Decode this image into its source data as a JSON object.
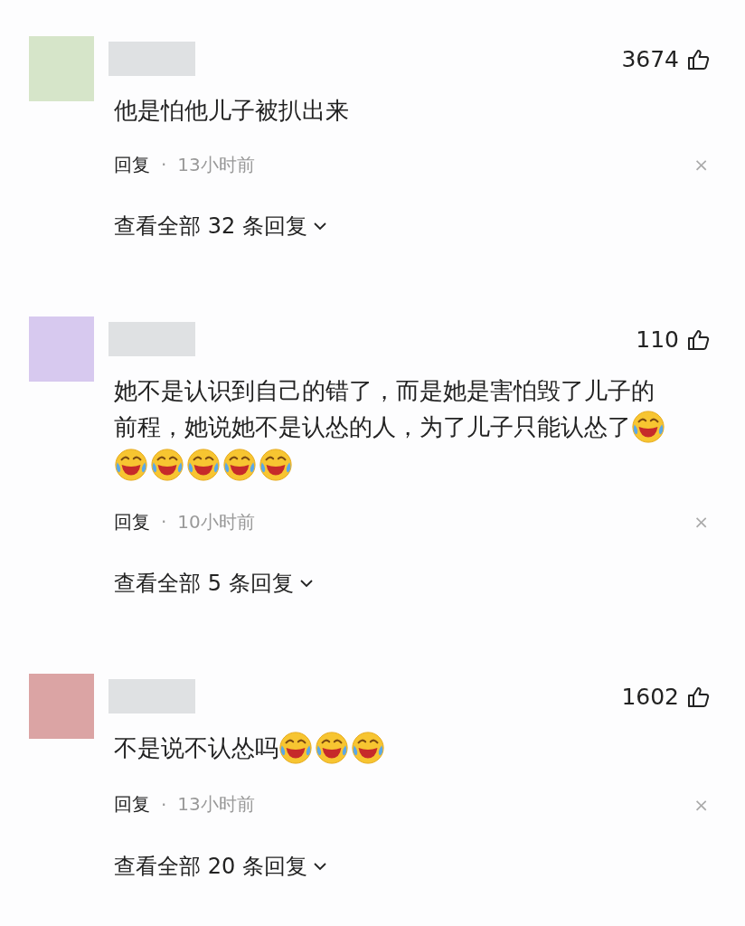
{
  "comments": [
    {
      "avatar": {
        "color": "#d6e5c9"
      },
      "author": {
        "kind": "redacted"
      },
      "likes": "3674",
      "content": [
        {
          "kind": "text",
          "text": "他是怕他儿子被扒出来"
        }
      ],
      "reply_label": "回复",
      "separator": "·",
      "time": "13小时前",
      "close": "×",
      "view_replies": "查看全部 32 条回复"
    },
    {
      "avatar": {
        "color": "#d7c9ef"
      },
      "author": {
        "kind": "redacted"
      },
      "likes": "110",
      "content": [
        {
          "kind": "text",
          "text": "她不是认识到自己的错了，而是她是害怕毁了儿子的"
        },
        {
          "kind": "text",
          "text": "前程，她说她不是认怂的人，为了儿子只能认怂了"
        },
        {
          "kind": "emoji"
        },
        {
          "kind": "emoji"
        },
        {
          "kind": "emoji"
        },
        {
          "kind": "emoji"
        },
        {
          "kind": "emoji"
        },
        {
          "kind": "emoji"
        }
      ],
      "reply_label": "回复",
      "separator": "·",
      "time": "10小时前",
      "close": "×",
      "view_replies": "查看全部 5 条回复"
    },
    {
      "avatar": {
        "color": "#dba4a4"
      },
      "author": {
        "kind": "redacted"
      },
      "likes": "1602",
      "content": [
        {
          "kind": "text",
          "text": "不是说不认怂吗"
        },
        {
          "kind": "emoji"
        },
        {
          "kind": "emoji"
        },
        {
          "kind": "emoji"
        }
      ],
      "reply_label": "回复",
      "separator": "·",
      "time": "13小时前",
      "close": "×",
      "view_replies": "查看全部 20 条回复"
    }
  ]
}
